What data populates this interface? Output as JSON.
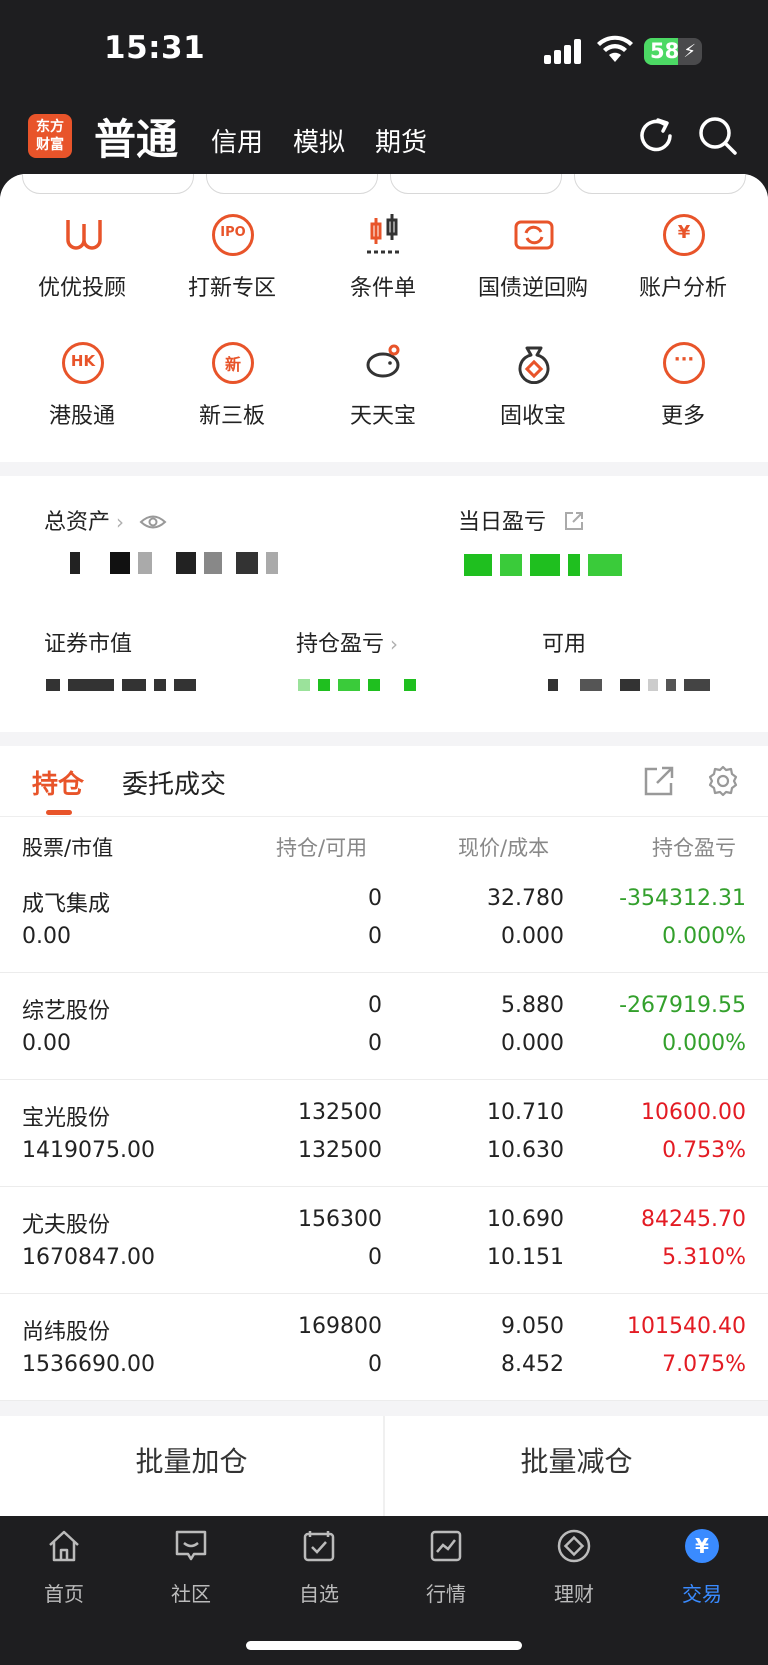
{
  "status": {
    "time": "15:31",
    "battery": "58",
    "battery_level": 0.58
  },
  "header": {
    "logo": "东方财富",
    "tab_main": "普通",
    "tabs": [
      "信用",
      "模拟",
      "期货"
    ]
  },
  "grid": [
    {
      "label": "优优投顾",
      "icon": "U"
    },
    {
      "label": "打新专区",
      "icon": "IPO"
    },
    {
      "label": "条件单",
      "icon": "candles"
    },
    {
      "label": "国债逆回购",
      "icon": "swap"
    },
    {
      "label": "账户分析",
      "icon": "¥"
    },
    {
      "label": "港股通",
      "icon": "HK"
    },
    {
      "label": "新三板",
      "icon": "新"
    },
    {
      "label": "天天宝",
      "icon": "pig"
    },
    {
      "label": "固收宝",
      "icon": "bag"
    },
    {
      "label": "更多",
      "icon": "..."
    }
  ],
  "assets": {
    "total_assets_label": "总资产",
    "daily_pnl_label": "当日盈亏",
    "market_value_label": "证券市值",
    "position_pnl_label": "持仓盈亏",
    "available_label": "可用"
  },
  "holdings": {
    "tab_positions": "持仓",
    "tab_orders": "委托成交",
    "columns": [
      "股票/市值",
      "持仓/可用",
      "现价/成本",
      "持仓盈亏"
    ],
    "rows": [
      {
        "name": "成飞集成",
        "market_value": "0.00",
        "position": "0",
        "available": "0",
        "price": "32.780",
        "cost": "0.000",
        "pnl": "-354312.31",
        "pnl_pct": "0.000%",
        "sign": "neg"
      },
      {
        "name": "综艺股份",
        "market_value": "0.00",
        "position": "0",
        "available": "0",
        "price": "5.880",
        "cost": "0.000",
        "pnl": "-267919.55",
        "pnl_pct": "0.000%",
        "sign": "neg"
      },
      {
        "name": "宝光股份",
        "market_value": "1419075.00",
        "position": "132500",
        "available": "132500",
        "price": "10.710",
        "cost": "10.630",
        "pnl": "10600.00",
        "pnl_pct": "0.753%",
        "sign": "pos"
      },
      {
        "name": "尤夫股份",
        "market_value": "1670847.00",
        "position": "156300",
        "available": "0",
        "price": "10.690",
        "cost": "10.151",
        "pnl": "84245.70",
        "pnl_pct": "5.310%",
        "sign": "pos"
      },
      {
        "name": "尚纬股份",
        "market_value": "1536690.00",
        "position": "169800",
        "available": "0",
        "price": "9.050",
        "cost": "8.452",
        "pnl": "101540.40",
        "pnl_pct": "7.075%",
        "sign": "pos"
      }
    ]
  },
  "actions": {
    "add": "批量加仓",
    "reduce": "批量减仓"
  },
  "nav": [
    {
      "label": "首页",
      "active": false
    },
    {
      "label": "社区",
      "active": false
    },
    {
      "label": "自选",
      "active": false
    },
    {
      "label": "行情",
      "active": false
    },
    {
      "label": "理财",
      "active": false
    },
    {
      "label": "交易",
      "active": true
    }
  ],
  "colors": {
    "accent": "#e8542a",
    "up": "#e31b23",
    "down": "#33a02c",
    "nav_active": "#3a8bff"
  }
}
